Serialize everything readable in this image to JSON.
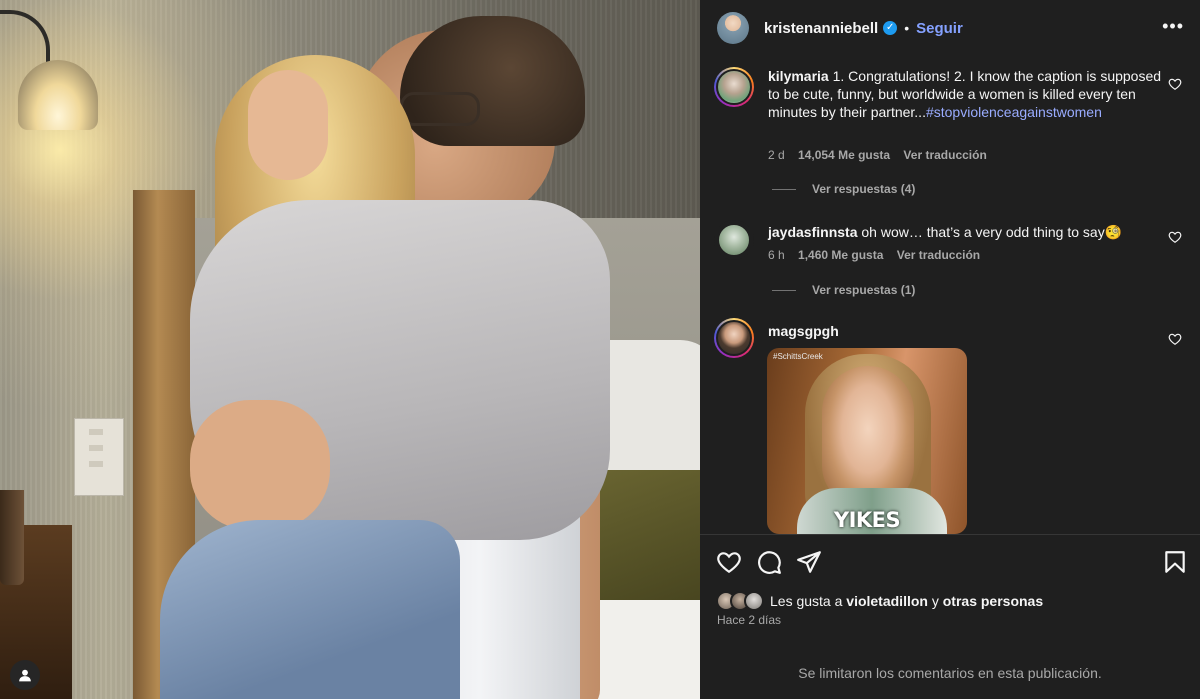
{
  "post": {
    "username": "kristenanniebell",
    "verified": true,
    "separator": "•",
    "follow_label": "Seguir",
    "more_label": "•••"
  },
  "comments": [
    {
      "username": "kilymaria",
      "text": " 1. Congratulations! 2. I know the caption is supposed to be cute, funny, but worldwide a women is killed every ten minutes by their partner...",
      "hashtag": "#stopviolenceagainstwomen",
      "age": "2 d",
      "likes": "14,054 Me gusta",
      "translate": "Ver traducción",
      "replies": "Ver respuestas (4)",
      "story_ring": true
    },
    {
      "username": "jaydasfinnsta",
      "text": " oh wow… that’s a very odd thing to say🧐",
      "age": "6 h",
      "likes": "1,460 Me gusta",
      "translate": "Ver traducción",
      "replies": "Ver respuestas (1)",
      "story_ring": false
    },
    {
      "username": "magsgpgh",
      "gif_tag": "#SchittsCreek",
      "gif_caption": "YIKES",
      "story_ring": true
    }
  ],
  "footer": {
    "likes_prefix": "Les gusta a ",
    "likes_user": "violetadillon",
    "likes_mid": " y ",
    "likes_others": "otras personas",
    "time": "Hace 2 días",
    "limited_notice": "Se limitaron los comentarios en esta publicación."
  },
  "icons": [
    "heart-icon",
    "comment-icon",
    "share-icon",
    "bookmark-icon",
    "verified-icon",
    "more-icon",
    "user-icon"
  ],
  "colors": {
    "panel_bg": "#1f1f1f",
    "follow": "#85a1ff",
    "hashtag": "#9aacff",
    "muted": "#a8a8a8",
    "verified": "#1d9bf0"
  }
}
